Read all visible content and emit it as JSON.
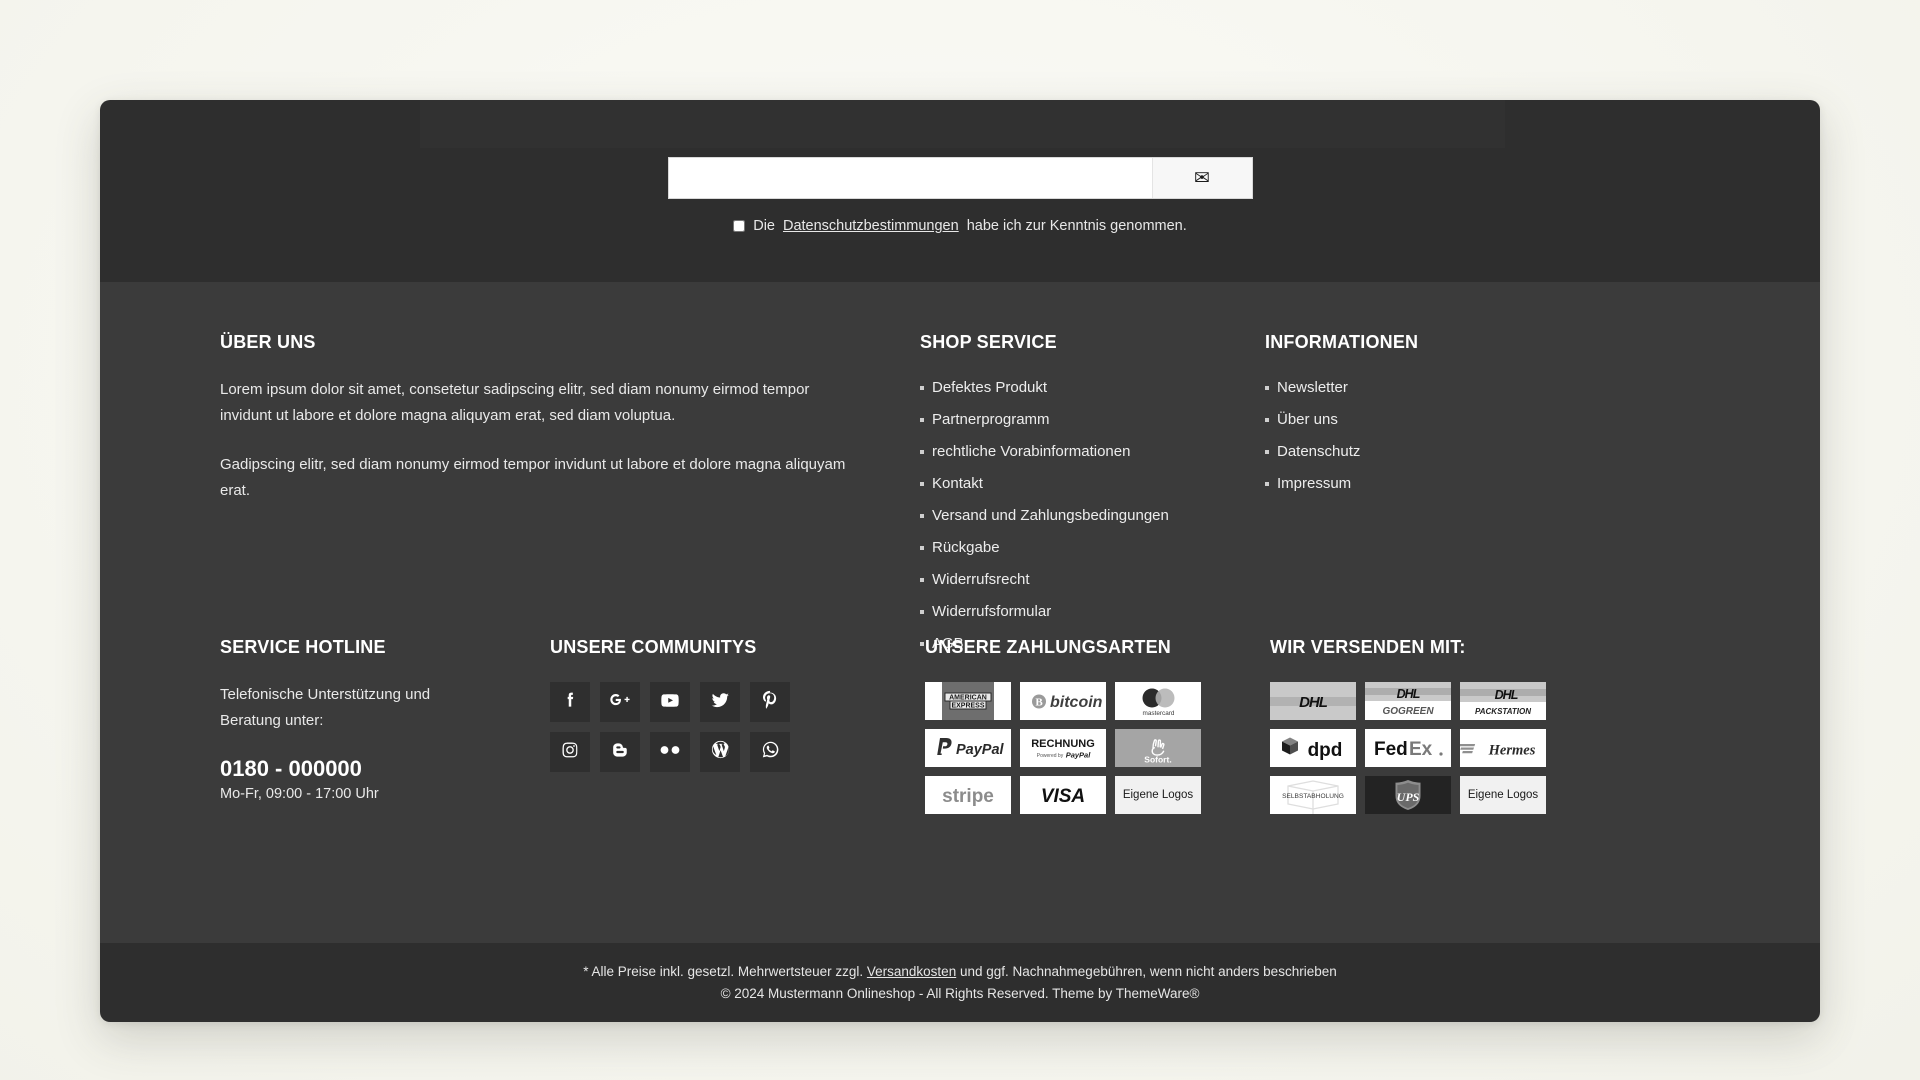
{
  "newsletter": {
    "input_placeholder": "",
    "input_value": "",
    "submit_icon": "envelope-icon",
    "submit_glyph": "✉",
    "privacy_prefix": "Die",
    "privacy_link": "Datenschutzbestimmungen",
    "privacy_suffix": "habe ich zur Kenntnis genommen.",
    "checkbox_checked": false
  },
  "about": {
    "title": "ÜBER UNS",
    "paragraph1": "Lorem ipsum dolor sit amet, consetetur sadipscing elitr, sed diam nonumy eirmod tempor invidunt ut labore et dolore magna aliquyam erat, sed diam voluptua.",
    "paragraph2": "Gadipscing elitr, sed diam nonumy eirmod tempor invidunt ut labore et dolore magna aliquyam erat."
  },
  "shop_service": {
    "title": "SHOP SERVICE",
    "items": [
      "Defektes Produkt",
      "Partnerprogramm",
      "rechtliche Vorabinformationen",
      "Kontakt",
      "Versand und Zahlungsbedingungen",
      "Rückgabe",
      "Widerrufsrecht",
      "Widerrufsformular",
      "AGB"
    ]
  },
  "informationen": {
    "title": "INFORMATIONEN",
    "items": [
      "Newsletter",
      "Über uns",
      "Datenschutz",
      "Impressum"
    ]
  },
  "hotline": {
    "title": "SERVICE HOTLINE",
    "description": "Telefonische Unterstützung und Beratung unter:",
    "number": "0180 - 000000",
    "hours": "Mo-Fr, 09:00 - 17:00 Uhr"
  },
  "communities": {
    "title": "UNSERE COMMUNITYS",
    "items": [
      {
        "name": "facebook-icon",
        "label": "Facebook"
      },
      {
        "name": "google-plus-icon",
        "label": "Google Plus"
      },
      {
        "name": "youtube-icon",
        "label": "YouTube"
      },
      {
        "name": "twitter-icon",
        "label": "Twitter"
      },
      {
        "name": "pinterest-icon",
        "label": "Pinterest"
      },
      {
        "name": "instagram-icon",
        "label": "Instagram"
      },
      {
        "name": "blogger-icon",
        "label": "Blogger"
      },
      {
        "name": "flickr-icon",
        "label": "Flickr"
      },
      {
        "name": "wordpress-icon",
        "label": "WordPress"
      },
      {
        "name": "whatsapp-icon",
        "label": "WhatsApp"
      }
    ]
  },
  "payments": {
    "title": "UNSERE ZAHLUNGSARTEN",
    "items": [
      {
        "name": "american-express-logo",
        "label": "AMERICAN EXPRESS",
        "style": "amex"
      },
      {
        "name": "bitcoin-logo",
        "label": "bitcoin",
        "style": "white"
      },
      {
        "name": "mastercard-logo",
        "label": "mastercard",
        "style": "white"
      },
      {
        "name": "paypal-logo",
        "label": "PayPal",
        "style": "white"
      },
      {
        "name": "rechnung-paypal-logo",
        "label": "RECHNUNG Powered by PayPal",
        "style": "white"
      },
      {
        "name": "sofort-logo",
        "label": "Sofort.",
        "style": "mid"
      },
      {
        "name": "stripe-logo",
        "label": "stripe",
        "style": "white"
      },
      {
        "name": "visa-logo",
        "label": "VISA",
        "style": "white"
      },
      {
        "name": "eigene-logos-payment",
        "label": "Eigene Logos",
        "style": "light"
      }
    ]
  },
  "shipping": {
    "title": "WIR VERSENDEN MIT:",
    "items": [
      {
        "name": "dhl-logo",
        "label": "DHL",
        "style": "gray"
      },
      {
        "name": "dhl-gogreen-logo",
        "label": "DHL GOGREEN",
        "style": "gray"
      },
      {
        "name": "dhl-packstation-logo",
        "label": "DHL PACKSTATION",
        "style": "gray"
      },
      {
        "name": "dpd-logo",
        "label": "dpd",
        "style": "white"
      },
      {
        "name": "fedex-logo",
        "label": "FedEx",
        "style": "white"
      },
      {
        "name": "hermes-logo",
        "label": "Hermes",
        "style": "white"
      },
      {
        "name": "selbstabholung-logo",
        "label": "SELBSTABHOLUNG",
        "style": "white"
      },
      {
        "name": "ups-logo",
        "label": "UPS",
        "style": "dark"
      },
      {
        "name": "eigene-logos-shipping",
        "label": "Eigene Logos",
        "style": "light"
      }
    ]
  },
  "footer_bar": {
    "line1_pre": "* Alle Preise inkl. gesetzl. Mehrwertsteuer zzgl.",
    "line1_link": "Versandkosten",
    "line1_post": "und ggf. Nachnahmegebühren, wenn nicht anders beschrieben",
    "line2": "© 2024 Mustermann Onlineshop - All Rights Reserved. Theme by ThemeWare®"
  },
  "colors": {
    "page_background": "#f7f7f1",
    "newsletter_band": "#2e2e2e",
    "footer_main": "#3b3b3b",
    "footer_bar": "#2e2e2e",
    "social_tile": "#2f2f2f",
    "text_primary": "#ffffff",
    "text_secondary": "#e9e9e9"
  }
}
